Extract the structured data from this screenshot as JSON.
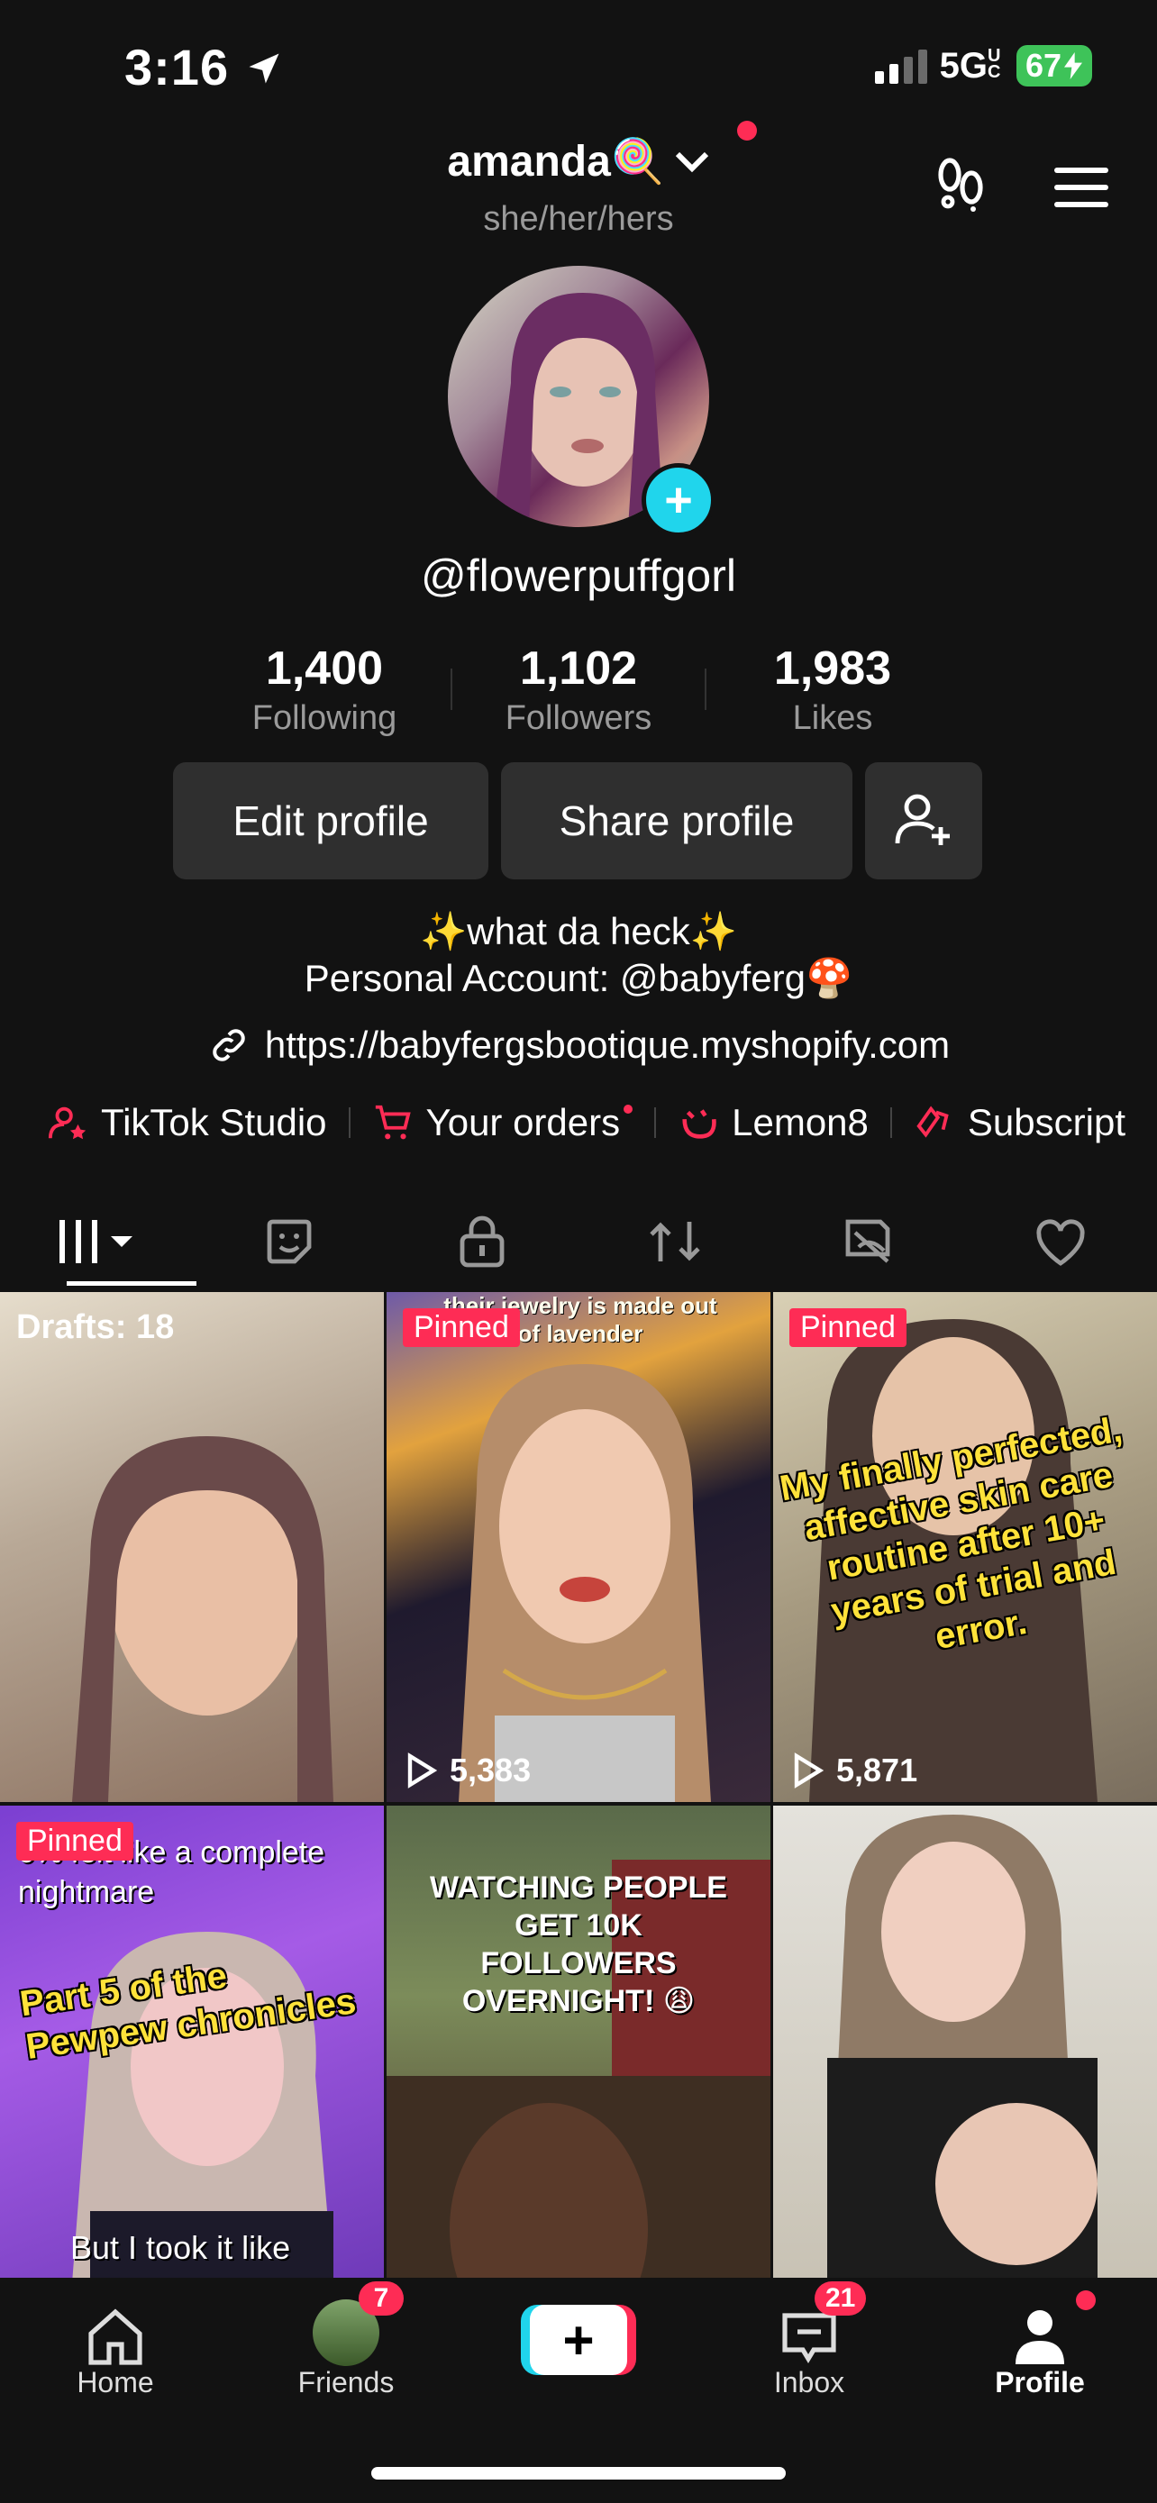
{
  "status": {
    "time": "3:16",
    "network": "5G",
    "network_suffix": "UC",
    "battery": "67"
  },
  "header": {
    "username": "amanda🍭",
    "pronouns": "she/her/hers"
  },
  "profile": {
    "handle": "@flowerpuffgorl",
    "stats": [
      {
        "num": "1,400",
        "label": "Following"
      },
      {
        "num": "1,102",
        "label": "Followers"
      },
      {
        "num": "1,983",
        "label": "Likes"
      }
    ],
    "edit_label": "Edit profile",
    "share_label": "Share profile",
    "bio_line1": "✨what da heck✨",
    "bio_line2": "Personal Account: @babyferg🍄",
    "link": "https://babyfergsbootique.myshopify.com"
  },
  "shortcuts": [
    "TikTok Studio",
    "Your orders",
    "Lemon8",
    "Subscript"
  ],
  "grid": {
    "drafts_label": "Drafts: 18",
    "pinned_label": "Pinned",
    "cells": [
      {
        "views": ""
      },
      {
        "views": "5,383",
        "caption": "their jewelry is made out of lavender"
      },
      {
        "views": "5,871",
        "caption": "My finally perfected, affective skin care routine after 10+ years of trial and error."
      },
      {
        "views": "",
        "caption_top": "0% felt like a complete nightmare",
        "caption_mid": "Part 5 of the Pewpew chronicles",
        "caption_bot": "But I took it like"
      },
      {
        "views": "",
        "caption": "WATCHING PEOPLE GET 10K FOLLOWERS OVERNIGHT! 😩"
      },
      {
        "views": ""
      }
    ]
  },
  "nav": {
    "home": "Home",
    "friends": "Friends",
    "friends_badge": "7",
    "inbox": "Inbox",
    "inbox_badge": "21",
    "profile": "Profile"
  },
  "colors": {
    "accent": "#fe2c55",
    "cyan": "#20d5ec",
    "background": "#121212"
  }
}
